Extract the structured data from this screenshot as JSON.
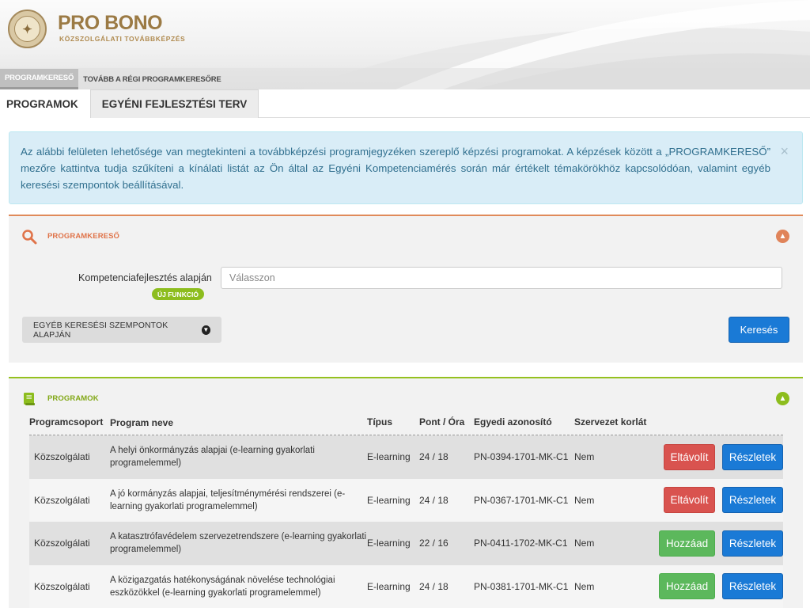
{
  "header": {
    "brand_title": "PRO BONO",
    "brand_subtitle": "KÖZSZOLGÁLATI TOVÁBBKÉPZÉS",
    "nav": [
      "PROGRAMKERESŐ",
      "TOVÁBB A RÉGI PROGRAMKERESŐRE"
    ]
  },
  "tabs": [
    "PROGRAMOK",
    "EGYÉNI FEJLESZTÉSI TERV"
  ],
  "alert": {
    "text": "Az alábbi felületen lehetősége van megtekinteni a továbbképzési programjegyzéken szereplő képzési programokat. A képzések között a „PROGRAMKERESŐ” mezőre kattintva tudja szűkíteni a kínálati listát az Ön által az Egyéni Kompetenciamérés során már értékelt témakörökhöz kapcsolódóan, valamint egyéb keresési szempontok beállításával.",
    "close": "×"
  },
  "search_panel": {
    "title": "PROGRAMKERESŐ",
    "field_label": "Kompetenciafejlesztés alapján",
    "new_badge": "ÚJ FUNKCIÓ",
    "select_placeholder": "Válasszon",
    "more_button": "EGYÉB KERESÉSI SZEMPONTOK ALAPJÁN",
    "search_button": "Keresés"
  },
  "programs_panel": {
    "title": "PROGRAMOK",
    "columns": [
      "Programcsoport",
      "Program neve",
      "Típus",
      "Pont / Óra",
      "Egyedi azonosító",
      "Szervezet korlát"
    ],
    "rows": [
      {
        "group": "Közszolgálati",
        "name": "A helyi önkormányzás alapjai (e-learning gyakorlati programelemmel)",
        "type": "E-learning",
        "points": "24 / 18",
        "id": "PN-0394-1701-MK-C1",
        "limit": "Nem",
        "action": "Eltávolít",
        "action_kind": "remove",
        "details": "Részletek"
      },
      {
        "group": "Közszolgálati",
        "name": "A jó kormányzás alapjai, teljesítménymérési rendszerei (e-learning gyakorlati programelemmel)",
        "type": "E-learning",
        "points": "24 / 18",
        "id": "PN-0367-1701-MK-C1",
        "limit": "Nem",
        "action": "Eltávolít",
        "action_kind": "remove",
        "details": "Részletek"
      },
      {
        "group": "Közszolgálati",
        "name": "A katasztrófavédelem szervezetrendszere (e-learning gyakorlati programelemmel)",
        "type": "E-learning",
        "points": "22 / 16",
        "id": "PN-0411-1702-MK-C1",
        "limit": "Nem",
        "action": "Hozzáad",
        "action_kind": "add",
        "details": "Részletek"
      },
      {
        "group": "Közszolgálati",
        "name": "A közigazgatás hatékonyságának növelése technológiai eszközökkel (e-learning gyakorlati programelemmel)",
        "type": "E-learning",
        "points": "24 / 18",
        "id": "PN-0381-1701-MK-C1",
        "limit": "Nem",
        "action": "Hozzáad",
        "action_kind": "add",
        "details": "Részletek"
      }
    ]
  },
  "colors": {
    "search_accent": "#e0744a",
    "programs_accent": "#82a817",
    "primary_button": "#1a7ad6",
    "remove_button": "#d9534f",
    "add_button": "#5cb85c",
    "alert_bg": "#d9edf7"
  }
}
